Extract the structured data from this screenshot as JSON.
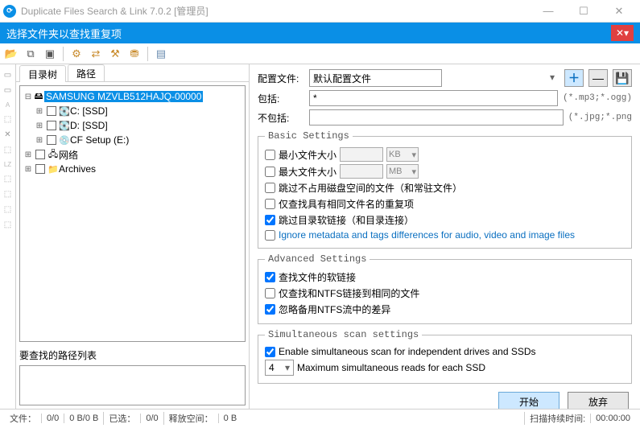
{
  "window": {
    "title": "Duplicate Files Search & Link 7.0.2 [管理员]"
  },
  "subheader": {
    "title": "选择文件夹以查找重复项"
  },
  "tabs": {
    "tree": "目录树",
    "path": "路径"
  },
  "tree": {
    "root": "SAMSUNG MZVLB512HAJQ-00000",
    "drive_c": "C: [SSD]",
    "drive_d": "D: [SSD]",
    "drive_e": "CF Setup (E:)",
    "network": "网络",
    "archives": "Archives"
  },
  "left": {
    "pathlist_label": "要查找的路径列表"
  },
  "config": {
    "profile_label": "配置文件:",
    "profile_value": "默认配置文件",
    "include_label": "包括:",
    "include_value": "*",
    "include_hint": "(*.mp3;*.ogg)",
    "exclude_label": "不包括:",
    "exclude_value": "",
    "exclude_hint": "(*.jpg;*.png"
  },
  "basic": {
    "legend": "Basic Settings",
    "min_size": "最小文件大小",
    "max_size": "最大文件大小",
    "unit_kb": "KB",
    "unit_mb": "MB",
    "skip_zero": "跳过不占用磁盘空间的文件（和常驻文件）",
    "same_name_only": "仅查找具有相同文件名的重复项",
    "skip_symlink": "跳过目录软链接（和目录连接）",
    "ignore_meta": "Ignore metadata and tags differences for audio, video and image files"
  },
  "advanced": {
    "legend": "Advanced Settings",
    "find_symlinks": "查找文件的软链接",
    "only_ntfs_same": "仅查找和NTFS链接到相同的文件",
    "ignore_ntfs_diff": "忽略备用NTFS流中的差异"
  },
  "simul": {
    "legend": "Simultaneous scan settings",
    "enable": "Enable simultaneous scan for independent drives and SSDs",
    "n": "4",
    "max_reads": "Maximum simultaneous reads for each SSD"
  },
  "buttons": {
    "start": "开始",
    "cancel": "放弃"
  },
  "status": {
    "files": "文件：",
    "v1": "0/0",
    "v2": "0 B/0 B",
    "selected": "已选：",
    "v3": "0/0",
    "free": "释放空间：",
    "v4": "0 B",
    "scan_time": "扫描持续时间:",
    "time": "00:00:00"
  }
}
